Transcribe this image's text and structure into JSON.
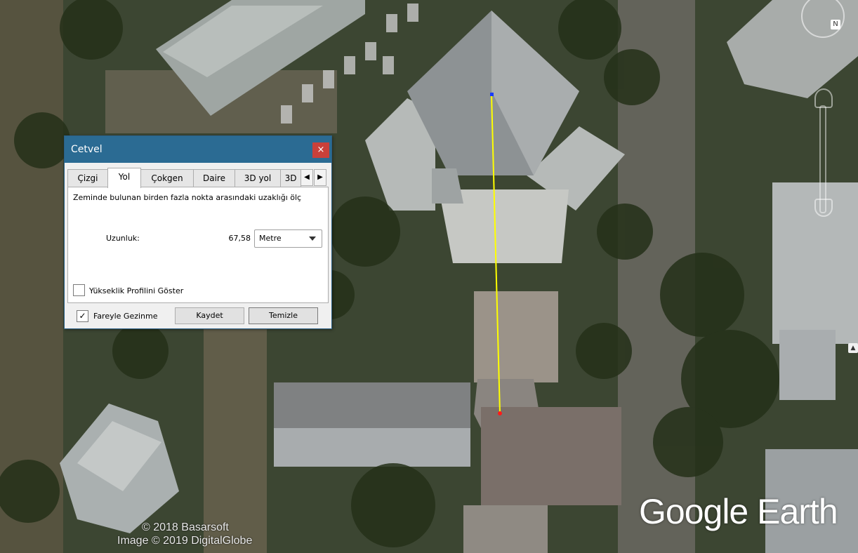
{
  "dialog": {
    "title": "Cetvel",
    "close_label": "×",
    "tabs": [
      {
        "label": "Çizgi"
      },
      {
        "label": "Yol"
      },
      {
        "label": "Çokgen"
      },
      {
        "label": "Daire"
      },
      {
        "label": "3D yol"
      },
      {
        "label": "3D"
      }
    ],
    "active_tab": "Yol",
    "scroll_left": "◀",
    "scroll_right": "▶",
    "description": "Zeminde bulunan birden fazla nokta arasındaki uzaklığı ölç",
    "length_label": "Uzunluk:",
    "length_value": "67,58",
    "unit_selected": "Metre",
    "elevation_checkbox_label": "Yükseklik Profilini Göster",
    "elevation_checked": false,
    "mouse_nav_label": "Fareyle Gezinme",
    "mouse_nav_checked": true,
    "mouse_nav_check_mark": "✓",
    "save_button": "Kaydet",
    "clear_button": "Temizle"
  },
  "overlay": {
    "copyright_line1": "© 2018 Basarsoft",
    "copyright_line2": "Image © 2019 DigitalGlobe",
    "brand": "Google Earth",
    "nav_north_icon": "N",
    "side_icon": "▲"
  },
  "colors": {
    "path_line": "#ffff00",
    "start_point": "#1a3cff",
    "end_point": "#ff1a1a",
    "title_bar": "#2b6b93",
    "close_button": "#c9403a"
  }
}
